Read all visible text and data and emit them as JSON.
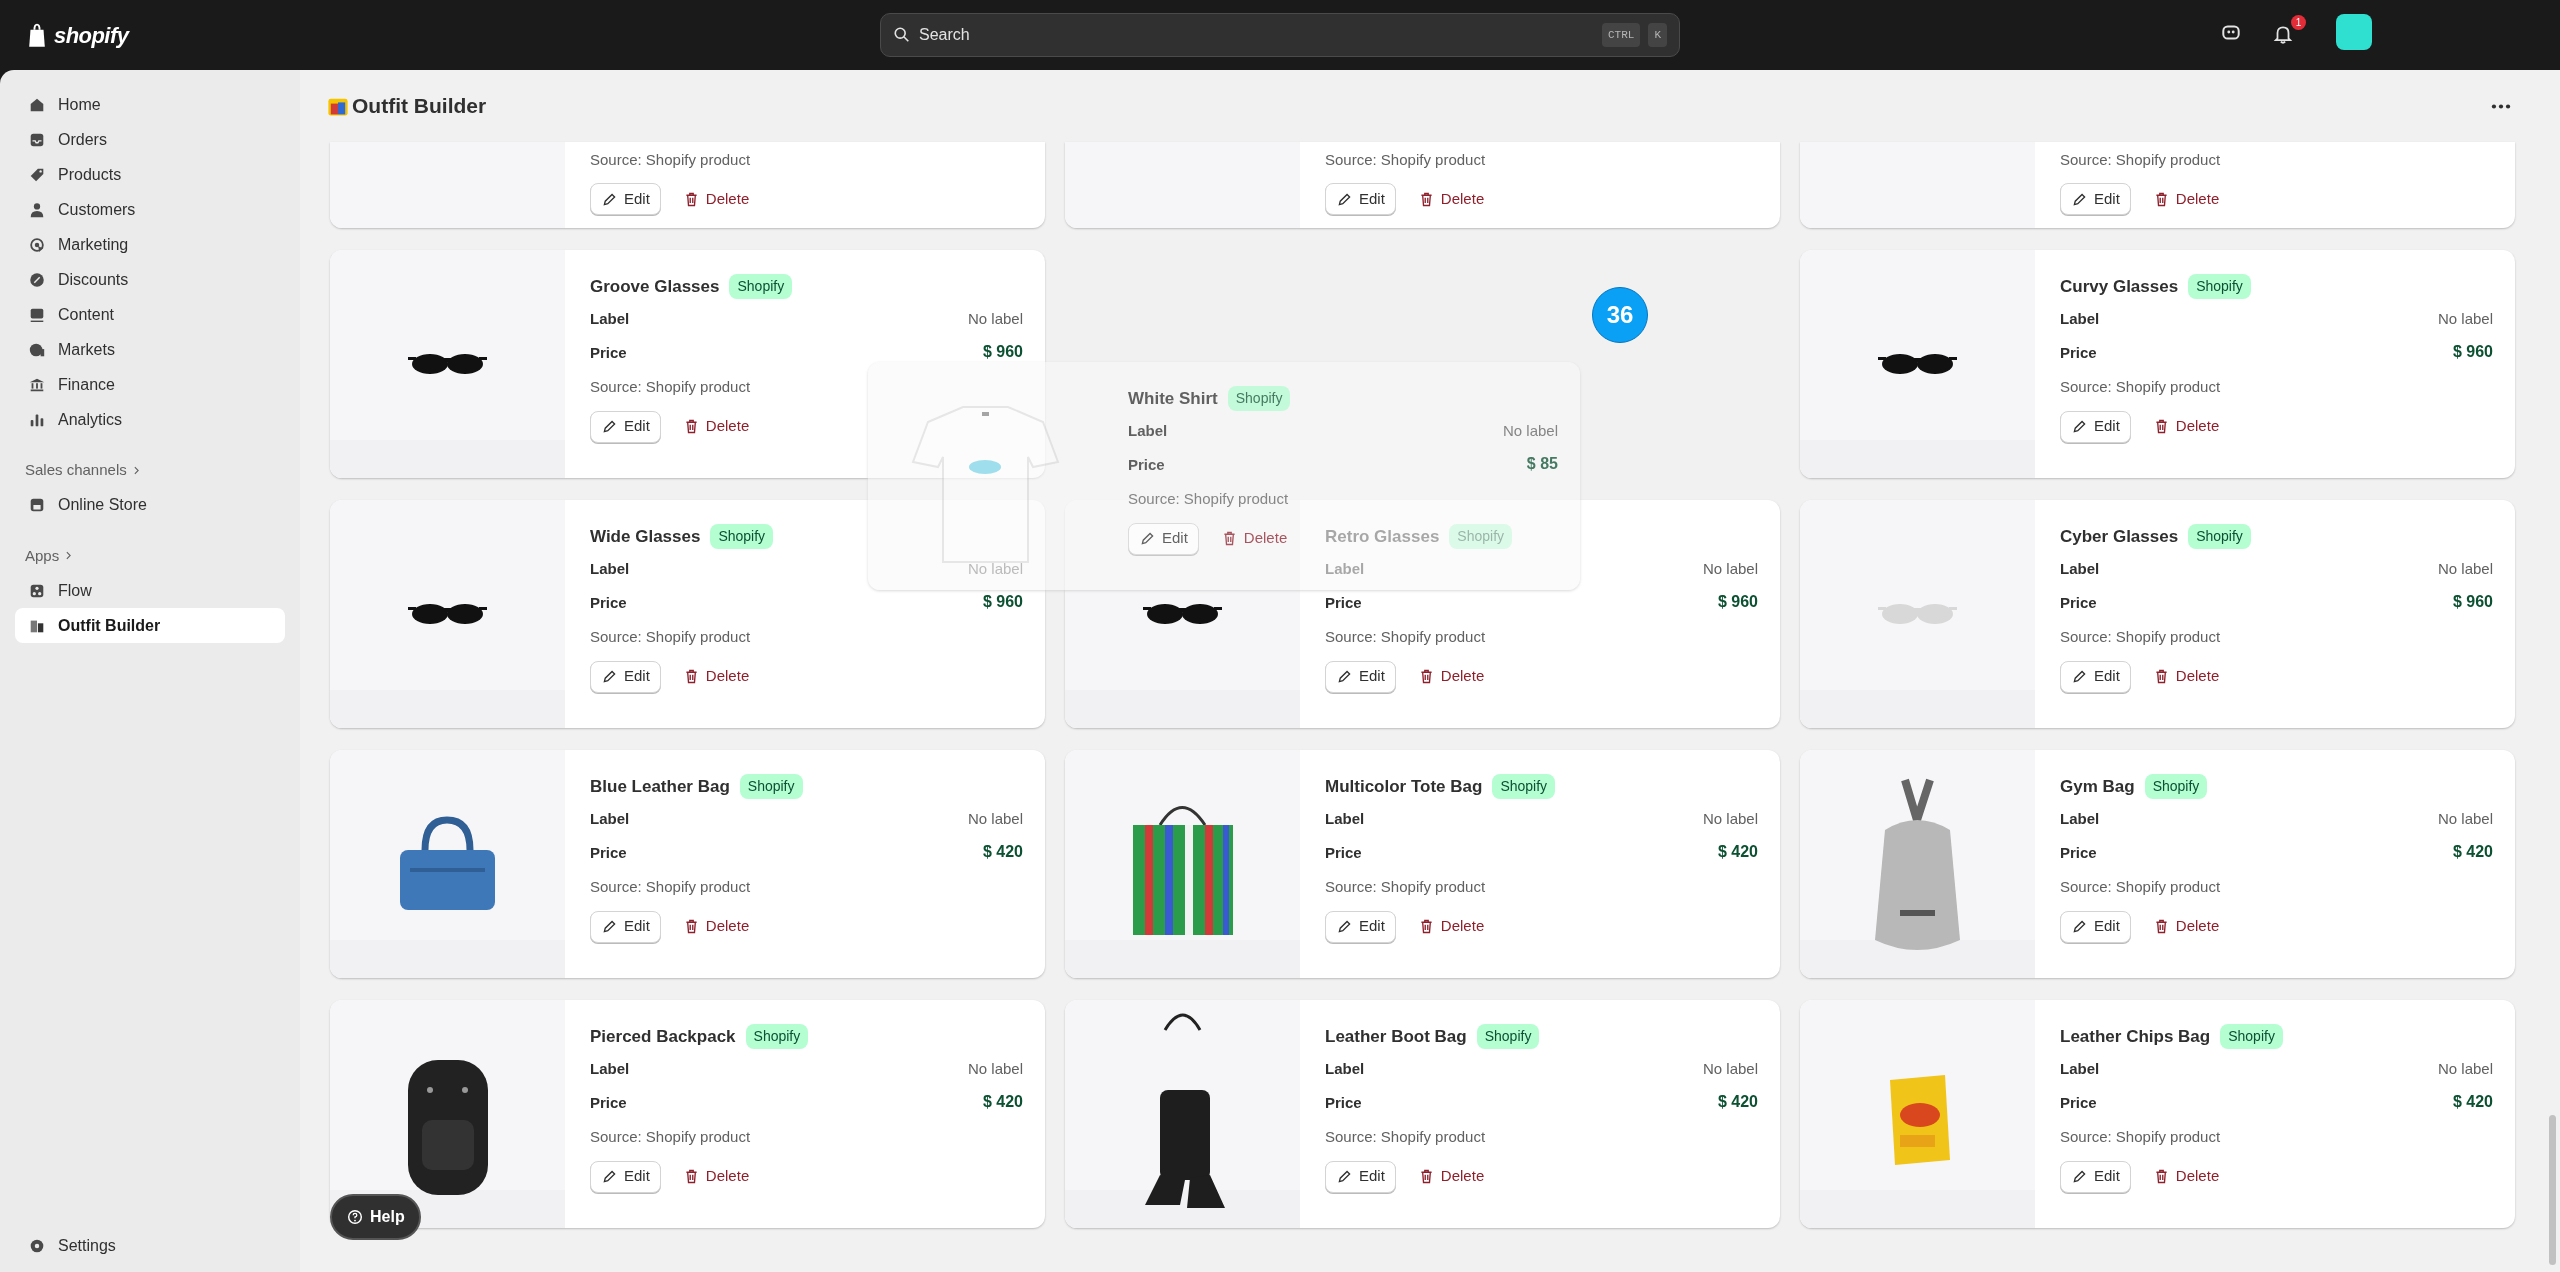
{
  "topbar": {
    "logo": "shopify",
    "search": {
      "placeholder": "Search",
      "keys": [
        "CTRL",
        "K"
      ]
    },
    "notification_count": "1"
  },
  "sidebar": {
    "groups": [
      {
        "items": [
          {
            "label": "Home",
            "selected": false
          },
          {
            "label": "Orders",
            "selected": false
          },
          {
            "label": "Products",
            "selected": false
          },
          {
            "label": "Customers",
            "selected": false
          },
          {
            "label": "Marketing",
            "selected": false
          },
          {
            "label": "Discounts",
            "selected": false
          },
          {
            "label": "Content",
            "selected": false
          },
          {
            "label": "Markets",
            "selected": false
          },
          {
            "label": "Finance",
            "selected": false
          },
          {
            "label": "Analytics",
            "selected": false
          }
        ]
      },
      {
        "heading": "Sales channels",
        "items": [
          {
            "label": "Online Store",
            "selected": false
          }
        ]
      },
      {
        "heading": "Apps",
        "items": [
          {
            "label": "Flow",
            "selected": false
          },
          {
            "label": "Outfit Builder",
            "selected": true
          }
        ]
      }
    ],
    "settings": "Settings"
  },
  "page": {
    "title": "Outfit Builder"
  },
  "partial_row": [
    {
      "source": "Source: Shopify product",
      "edit": "Edit",
      "delete": "Delete"
    },
    {
      "source": "Source: Shopify product",
      "edit": "Edit",
      "delete": "Delete"
    },
    {
      "source": "Source: Shopify product",
      "edit": "Edit",
      "delete": "Delete"
    }
  ],
  "slots": [
    {
      "kind": "product",
      "name": "Groove Glasses",
      "badge": "Shopify",
      "label_heading": "Label",
      "label": "No label",
      "price_heading": "Price",
      "price": "$ 960",
      "source": "Source: Shopify product",
      "edit": "Edit",
      "delete": "Delete"
    },
    {
      "kind": "empty"
    },
    {
      "kind": "product",
      "name": "Curvy Glasses",
      "badge": "Shopify",
      "label_heading": "Label",
      "label": "No label",
      "price_heading": "Price",
      "price": "$ 960",
      "source": "Source: Shopify product",
      "edit": "Edit",
      "delete": "Delete"
    },
    {
      "kind": "product",
      "name": "Wide Glasses",
      "badge": "Shopify",
      "label_heading": "Label",
      "label": "No label",
      "price_heading": "Price",
      "price": "$ 960",
      "source": "Source: Shopify product",
      "edit": "Edit",
      "delete": "Delete"
    },
    {
      "kind": "product",
      "name": "Retro Glasses",
      "badge": "Shopify",
      "label_heading": "Label",
      "label": "No label",
      "price_heading": "Price",
      "price": "$ 960",
      "source": "Source: Shopify product",
      "edit": "Edit",
      "delete": "Delete"
    },
    {
      "kind": "product",
      "name": "Cyber Glasses",
      "badge": "Shopify",
      "label_heading": "Label",
      "label": "No label",
      "price_heading": "Price",
      "price": "$ 960",
      "source": "Source: Shopify product",
      "edit": "Edit",
      "delete": "Delete"
    },
    {
      "kind": "product",
      "name": "Blue Leather Bag",
      "badge": "Shopify",
      "label_heading": "Label",
      "label": "No label",
      "price_heading": "Price",
      "price": "$ 420",
      "source": "Source: Shopify product",
      "edit": "Edit",
      "delete": "Delete"
    },
    {
      "kind": "product",
      "name": "Multicolor Tote Bag",
      "badge": "Shopify",
      "label_heading": "Label",
      "label": "No label",
      "price_heading": "Price",
      "price": "$ 420",
      "source": "Source: Shopify product",
      "edit": "Edit",
      "delete": "Delete"
    },
    {
      "kind": "product",
      "name": "Gym Bag",
      "badge": "Shopify",
      "label_heading": "Label",
      "label": "No label",
      "price_heading": "Price",
      "price": "$ 420",
      "source": "Source: Shopify product",
      "edit": "Edit",
      "delete": "Delete"
    },
    {
      "kind": "product",
      "name": "Pierced Backpack",
      "badge": "Shopify",
      "label_heading": "Label",
      "label": "No label",
      "price_heading": "Price",
      "price": "$ 420",
      "source": "Source: Shopify product",
      "edit": "Edit",
      "delete": "Delete"
    },
    {
      "kind": "product",
      "name": "Leather Boot Bag",
      "badge": "Shopify",
      "label_heading": "Label",
      "label": "No label",
      "price_heading": "Price",
      "price": "$ 420",
      "source": "Source: Shopify product",
      "edit": "Edit",
      "delete": "Delete"
    },
    {
      "kind": "product",
      "name": "Leather Chips Bag",
      "badge": "Shopify",
      "label_heading": "Label",
      "label": "No label",
      "price_heading": "Price",
      "price": "$ 420",
      "source": "Source: Shopify product",
      "edit": "Edit",
      "delete": "Delete"
    }
  ],
  "dragging": {
    "name": "White Shirt",
    "badge": "Shopify",
    "label_heading": "Label",
    "label": "No label",
    "price_heading": "Price",
    "price": "$ 85",
    "source": "Source: Shopify product",
    "edit": "Edit",
    "delete": "Delete",
    "count": "36"
  },
  "help": "Help"
}
